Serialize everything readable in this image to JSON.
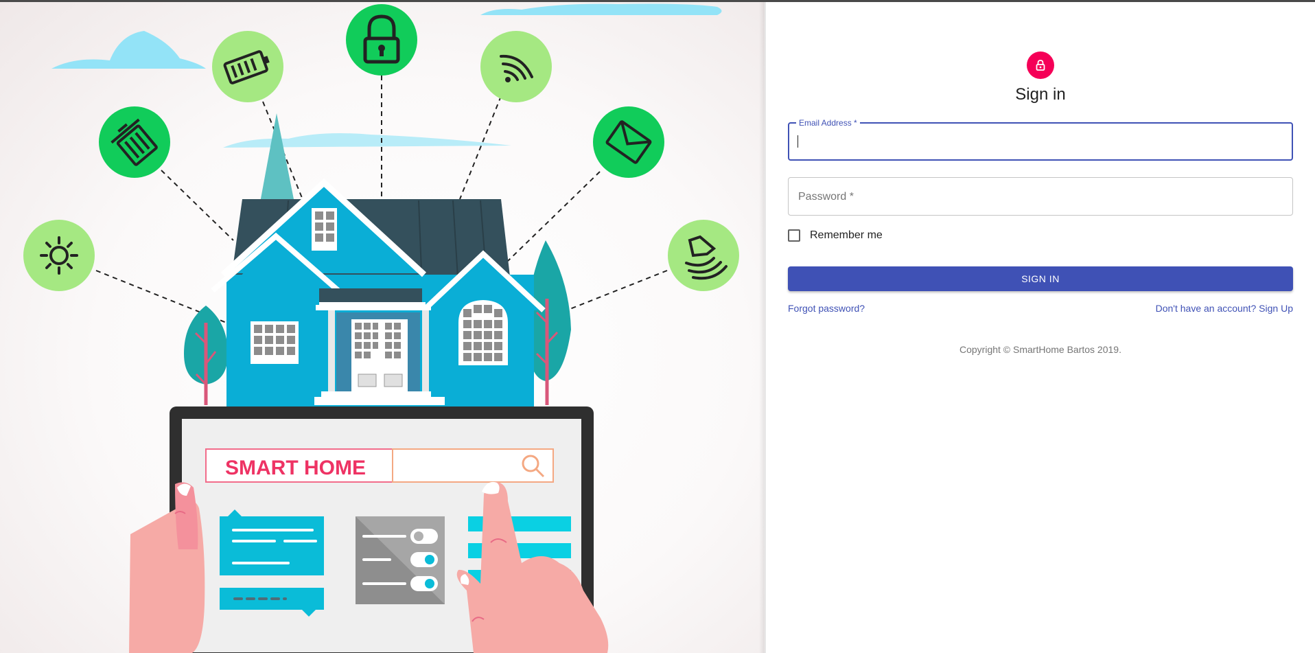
{
  "hero": {
    "screen_text": "SMART HOME",
    "illustration_icons": [
      "battery-icon",
      "padlock-icon",
      "wifi-icon",
      "trash-icon",
      "mail-icon",
      "sun-icon",
      "lamp-icon",
      "search-icon"
    ]
  },
  "colors": {
    "primary": "#3f51b5",
    "avatar": "#f50057",
    "icon_green_light": "#a5e882",
    "icon_green_dark": "#11cc5a",
    "house_blue": "#0aaed6"
  },
  "form": {
    "lock_icon": "lock-icon",
    "title": "Sign in",
    "email_label": "Email Address *",
    "email_value": "",
    "password_label": "Password *",
    "password_value": "",
    "remember_label": "Remember me",
    "remember_checked": false,
    "submit_label": "SIGN IN",
    "forgot_link": "Forgot password?",
    "signup_link": "Don't have an account? Sign Up",
    "copyright": "Copyright © SmartHome Bartos 2019."
  }
}
